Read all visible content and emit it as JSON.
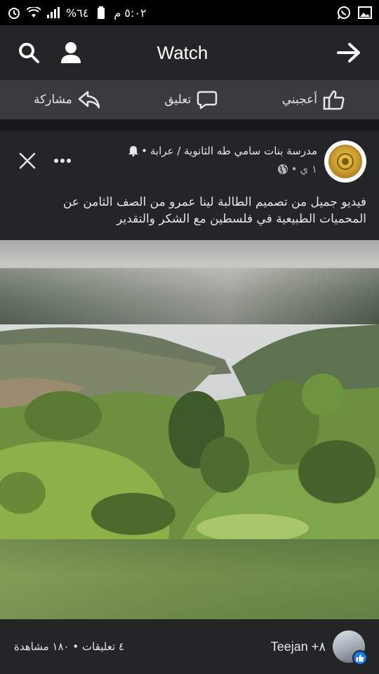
{
  "status_bar": {
    "time": "٥:٠٢ م",
    "battery": "٦٤%"
  },
  "header": {
    "title": "Watch"
  },
  "actions": {
    "like": "أعجبني",
    "comment": "تعليق",
    "share": "مشاركة"
  },
  "post": {
    "page_name": "مدرسة بنات سامي طه الثانوية / عرابة",
    "time": "١ ي",
    "text_line1": "فيديو جميل من تصميم الطالبة لينا عمرو من الصف الثامن عن",
    "text_line2": "المحميات الطبيعية في فلسطين مع الشكر والتقدير"
  },
  "footer": {
    "reactors": "Teejan +٨",
    "stats": "٤ تعليقات • ١٨٠ مشاهدة"
  }
}
